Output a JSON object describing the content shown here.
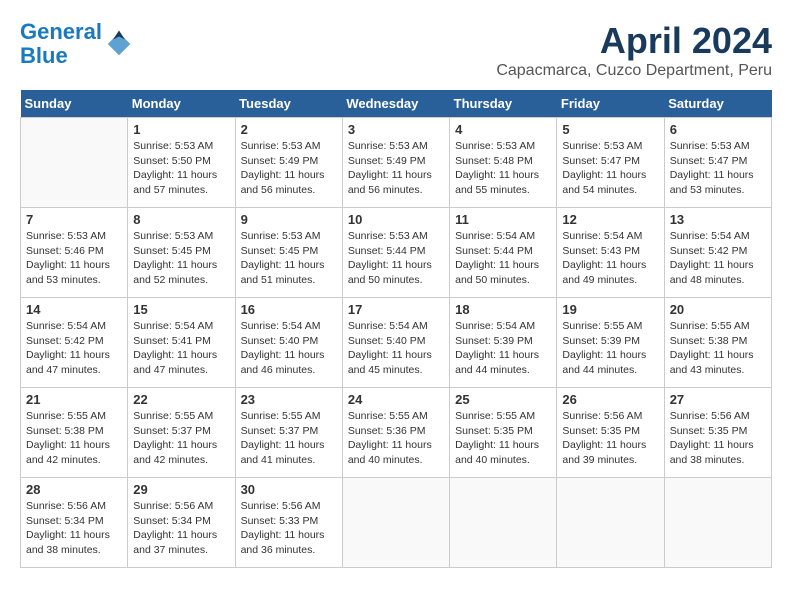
{
  "logo": {
    "line1": "General",
    "line2": "Blue"
  },
  "title": "April 2024",
  "subtitle": "Capacmarca, Cuzco Department, Peru",
  "days_of_week": [
    "Sunday",
    "Monday",
    "Tuesday",
    "Wednesday",
    "Thursday",
    "Friday",
    "Saturday"
  ],
  "weeks": [
    [
      {
        "day": "",
        "info": ""
      },
      {
        "day": "1",
        "info": "Sunrise: 5:53 AM\nSunset: 5:50 PM\nDaylight: 11 hours\nand 57 minutes."
      },
      {
        "day": "2",
        "info": "Sunrise: 5:53 AM\nSunset: 5:49 PM\nDaylight: 11 hours\nand 56 minutes."
      },
      {
        "day": "3",
        "info": "Sunrise: 5:53 AM\nSunset: 5:49 PM\nDaylight: 11 hours\nand 56 minutes."
      },
      {
        "day": "4",
        "info": "Sunrise: 5:53 AM\nSunset: 5:48 PM\nDaylight: 11 hours\nand 55 minutes."
      },
      {
        "day": "5",
        "info": "Sunrise: 5:53 AM\nSunset: 5:47 PM\nDaylight: 11 hours\nand 54 minutes."
      },
      {
        "day": "6",
        "info": "Sunrise: 5:53 AM\nSunset: 5:47 PM\nDaylight: 11 hours\nand 53 minutes."
      }
    ],
    [
      {
        "day": "7",
        "info": "Sunrise: 5:53 AM\nSunset: 5:46 PM\nDaylight: 11 hours\nand 53 minutes."
      },
      {
        "day": "8",
        "info": "Sunrise: 5:53 AM\nSunset: 5:45 PM\nDaylight: 11 hours\nand 52 minutes."
      },
      {
        "day": "9",
        "info": "Sunrise: 5:53 AM\nSunset: 5:45 PM\nDaylight: 11 hours\nand 51 minutes."
      },
      {
        "day": "10",
        "info": "Sunrise: 5:53 AM\nSunset: 5:44 PM\nDaylight: 11 hours\nand 50 minutes."
      },
      {
        "day": "11",
        "info": "Sunrise: 5:54 AM\nSunset: 5:44 PM\nDaylight: 11 hours\nand 50 minutes."
      },
      {
        "day": "12",
        "info": "Sunrise: 5:54 AM\nSunset: 5:43 PM\nDaylight: 11 hours\nand 49 minutes."
      },
      {
        "day": "13",
        "info": "Sunrise: 5:54 AM\nSunset: 5:42 PM\nDaylight: 11 hours\nand 48 minutes."
      }
    ],
    [
      {
        "day": "14",
        "info": "Sunrise: 5:54 AM\nSunset: 5:42 PM\nDaylight: 11 hours\nand 47 minutes."
      },
      {
        "day": "15",
        "info": "Sunrise: 5:54 AM\nSunset: 5:41 PM\nDaylight: 11 hours\nand 47 minutes."
      },
      {
        "day": "16",
        "info": "Sunrise: 5:54 AM\nSunset: 5:40 PM\nDaylight: 11 hours\nand 46 minutes."
      },
      {
        "day": "17",
        "info": "Sunrise: 5:54 AM\nSunset: 5:40 PM\nDaylight: 11 hours\nand 45 minutes."
      },
      {
        "day": "18",
        "info": "Sunrise: 5:54 AM\nSunset: 5:39 PM\nDaylight: 11 hours\nand 44 minutes."
      },
      {
        "day": "19",
        "info": "Sunrise: 5:55 AM\nSunset: 5:39 PM\nDaylight: 11 hours\nand 44 minutes."
      },
      {
        "day": "20",
        "info": "Sunrise: 5:55 AM\nSunset: 5:38 PM\nDaylight: 11 hours\nand 43 minutes."
      }
    ],
    [
      {
        "day": "21",
        "info": "Sunrise: 5:55 AM\nSunset: 5:38 PM\nDaylight: 11 hours\nand 42 minutes."
      },
      {
        "day": "22",
        "info": "Sunrise: 5:55 AM\nSunset: 5:37 PM\nDaylight: 11 hours\nand 42 minutes."
      },
      {
        "day": "23",
        "info": "Sunrise: 5:55 AM\nSunset: 5:37 PM\nDaylight: 11 hours\nand 41 minutes."
      },
      {
        "day": "24",
        "info": "Sunrise: 5:55 AM\nSunset: 5:36 PM\nDaylight: 11 hours\nand 40 minutes."
      },
      {
        "day": "25",
        "info": "Sunrise: 5:55 AM\nSunset: 5:35 PM\nDaylight: 11 hours\nand 40 minutes."
      },
      {
        "day": "26",
        "info": "Sunrise: 5:56 AM\nSunset: 5:35 PM\nDaylight: 11 hours\nand 39 minutes."
      },
      {
        "day": "27",
        "info": "Sunrise: 5:56 AM\nSunset: 5:35 PM\nDaylight: 11 hours\nand 38 minutes."
      }
    ],
    [
      {
        "day": "28",
        "info": "Sunrise: 5:56 AM\nSunset: 5:34 PM\nDaylight: 11 hours\nand 38 minutes."
      },
      {
        "day": "29",
        "info": "Sunrise: 5:56 AM\nSunset: 5:34 PM\nDaylight: 11 hours\nand 37 minutes."
      },
      {
        "day": "30",
        "info": "Sunrise: 5:56 AM\nSunset: 5:33 PM\nDaylight: 11 hours\nand 36 minutes."
      },
      {
        "day": "",
        "info": ""
      },
      {
        "day": "",
        "info": ""
      },
      {
        "day": "",
        "info": ""
      },
      {
        "day": "",
        "info": ""
      }
    ]
  ]
}
